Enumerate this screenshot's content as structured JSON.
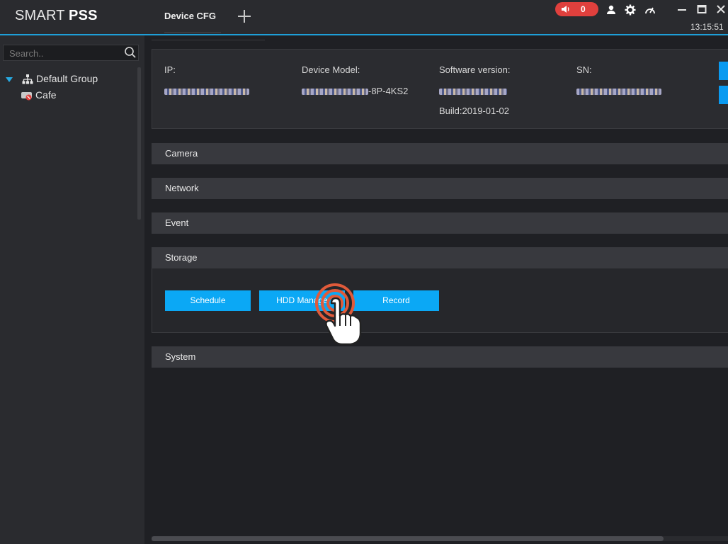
{
  "app": {
    "logo_regular": "SMART ",
    "logo_bold": "PSS"
  },
  "tabs": [
    {
      "label": "Device CFG"
    }
  ],
  "header": {
    "alarm_count": "0",
    "clock": "13:15:51",
    "icons": [
      "speaker-icon",
      "user-icon",
      "gear-icon",
      "gauge-icon",
      "minimize-icon",
      "maximize-icon",
      "close-icon"
    ]
  },
  "sidebar": {
    "search_placeholder": "Search..",
    "tree": {
      "group_label": "Default Group",
      "devices": [
        {
          "label": "Cafe"
        }
      ]
    }
  },
  "device_info": {
    "ip_label": "IP:",
    "model_label": "Device Model:",
    "model_suffix": "-8P-4KS2",
    "software_label": "Software version:",
    "build": "Build:2019-01-02",
    "sn_label": "SN:"
  },
  "sections": [
    {
      "title": "Camera"
    },
    {
      "title": "Network"
    },
    {
      "title": "Event"
    },
    {
      "title": "Storage"
    },
    {
      "title": "System"
    }
  ],
  "storage_buttons": [
    {
      "label": "Schedule"
    },
    {
      "label": "HDD Manage"
    },
    {
      "label": "Record"
    }
  ],
  "colors": {
    "accent": "#0ba8f5",
    "alarm": "#e0403d",
    "background": "#1f2024",
    "panel": "#2a2b2f"
  }
}
